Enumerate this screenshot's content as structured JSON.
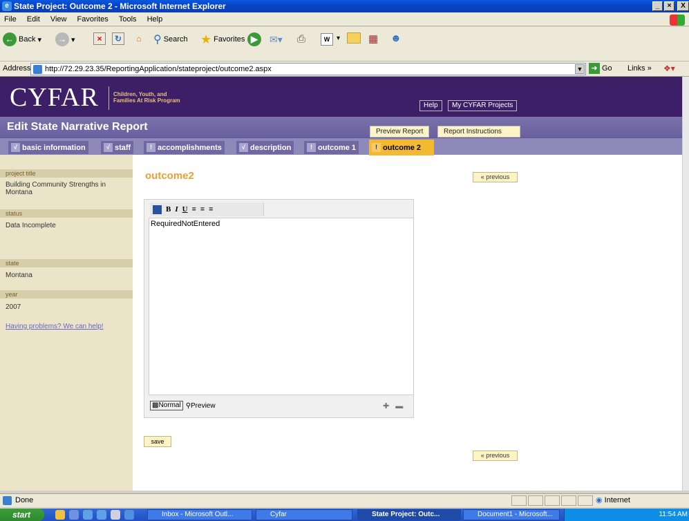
{
  "window": {
    "title": "State Project: Outcome 2 - Microsoft Internet Explorer",
    "min": "_",
    "max": "×",
    "close": "X"
  },
  "menu": [
    "File",
    "Edit",
    "View",
    "Favorites",
    "Tools",
    "Help"
  ],
  "toolbar": {
    "back": "Back",
    "search": "Search",
    "favorites": "Favorites",
    "edit_w": "W"
  },
  "address": {
    "label": "Address",
    "url": "http://72.29.23.35/ReportingApplication/stateproject/outcome2.aspx",
    "go": "Go",
    "links": "Links"
  },
  "site": {
    "logo": "CYFAR",
    "logo_sub1": "Children, Youth, and",
    "logo_sub2": "Families At Risk Program",
    "help": "Help",
    "my_projects": "My CYFAR Projects",
    "page_heading": "Edit State Narrative Report",
    "preview_report": "Preview Report",
    "report_instructions": "Report Instructions"
  },
  "tabs": [
    {
      "label": "basic information",
      "icon": "√"
    },
    {
      "label": "staff",
      "icon": "√"
    },
    {
      "label": "accomplishments",
      "icon": "!"
    },
    {
      "label": "description",
      "icon": "√"
    },
    {
      "label": "outcome 1",
      "icon": "!"
    },
    {
      "label": "outcome 2",
      "icon": "!"
    }
  ],
  "sidebar": {
    "project_title_label": "project title",
    "project_title": "Building Community Strengths in Montana",
    "status_label": "status",
    "status": "Data Incomplete",
    "state_label": "state",
    "state": "Montana",
    "year_label": "year",
    "year": "2007",
    "help_link": "Having problems? We can help!"
  },
  "main": {
    "title": "outcome2",
    "previous": "« previous",
    "editor_text": "RequiredNotEntered",
    "mode_normal": "Normal",
    "mode_preview": "Preview",
    "save": "save"
  },
  "status": {
    "text": "Done",
    "zone": "Internet"
  },
  "taskbar": {
    "start": "start",
    "items": [
      "Inbox - Microsoft Outl...",
      "Cyfar",
      "State Project: Outc...",
      "Document1 - Microsoft..."
    ],
    "clock": "11:54 AM"
  }
}
